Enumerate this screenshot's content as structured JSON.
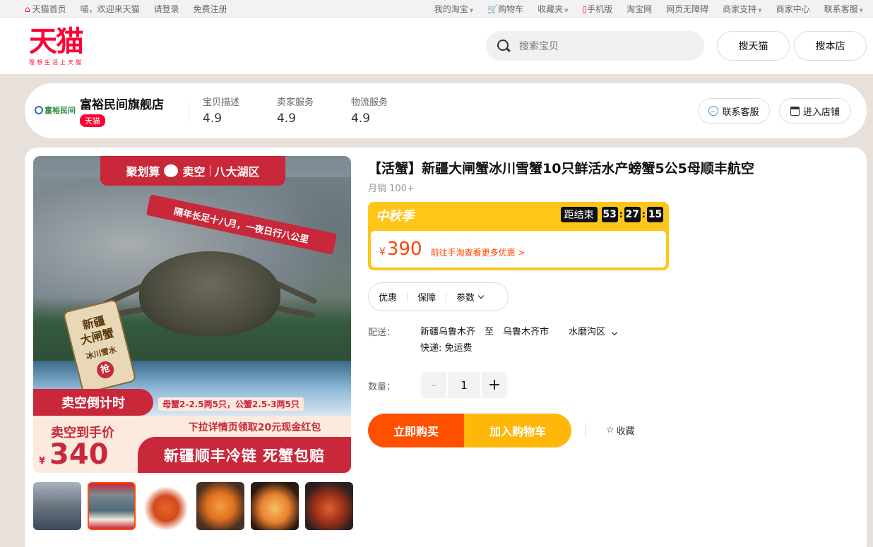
{
  "topbar": {
    "home": "天猫首页",
    "greeting": "喵，欢迎来天猫",
    "login": "请登录",
    "register": "免费注册",
    "my_taobao": "我的淘宝",
    "cart": "购物车",
    "favorites": "收藏夹",
    "mobile": "手机版",
    "taobao": "淘宝网",
    "accessible": "网页无障碍",
    "merchant_support": "商家支持",
    "merchant_center": "商家中心",
    "contact_service": "联系客服"
  },
  "header": {
    "logo_main": "天猫",
    "logo_slogan": "理想生活上天猫",
    "search_placeholder": "搜索宝贝",
    "search_tmall": "搜天猫",
    "search_store": "搜本店"
  },
  "shop": {
    "logo_text": "富裕民间",
    "name": "富裕民间旗舰店",
    "badge": "天猫",
    "ratings": [
      {
        "label": "宝贝描述",
        "value": "4.9"
      },
      {
        "label": "卖家服务",
        "value": "4.9"
      },
      {
        "label": "物流服务",
        "value": "4.9"
      }
    ],
    "contact_button": "联系客服",
    "enter_store_button": "进入店铺"
  },
  "product_image": {
    "banner_left": "聚划算",
    "banner_mid": "卖空",
    "banner_right": "八大湖区",
    "ribbon": "隔年长足十八月，一夜日行八公里",
    "tag_line1": "新疆",
    "tag_line2": "大闸蟹",
    "tag_small": "冰川雪水",
    "tag_grab": "抢",
    "countdown_badge": "卖空倒计时",
    "spec": "母蟹2-2.5两5只，公蟹2.5-3两5只",
    "bottom_left_label": "卖空到手价",
    "bottom_currency": "¥",
    "bottom_price": "340",
    "bottom_right_1": "下拉详情页领取20元现金红包",
    "bottom_right_2": "新疆顺丰冷链 死蟹包赔"
  },
  "product": {
    "title": "【活蟹】新疆大闸蟹冰川雪蟹10只鲜活水产螃蟹5公5母顺丰航空",
    "monthly_sales": "月销 100+",
    "promo_name": "中秋季",
    "countdown_label": "距结束",
    "countdown": [
      "53",
      "27",
      "15"
    ],
    "currency": "¥",
    "price": "390",
    "price_link": "前往手淘查看更多优惠 >",
    "tabs": [
      "优惠",
      "保障",
      "参数"
    ],
    "delivery_label": "配送：",
    "delivery_from": "新疆乌鲁木齐",
    "delivery_to_word": "至",
    "delivery_city": "乌鲁木齐市",
    "delivery_district": "水磨沟区",
    "shipping": "快递: 免运费",
    "qty_label": "数量：",
    "qty_minus": "-",
    "qty_value": "1",
    "qty_plus": "+",
    "buy_now": "立即购买",
    "add_to_cart": "加入购物车",
    "favorite": "收藏"
  },
  "colors": {
    "brand_red": "#ff0036",
    "buy_orange": "#ff5000",
    "cart_yellow": "#ffb70a",
    "promo_yellow": "#ffc61a",
    "price_orange": "#ff4400"
  }
}
